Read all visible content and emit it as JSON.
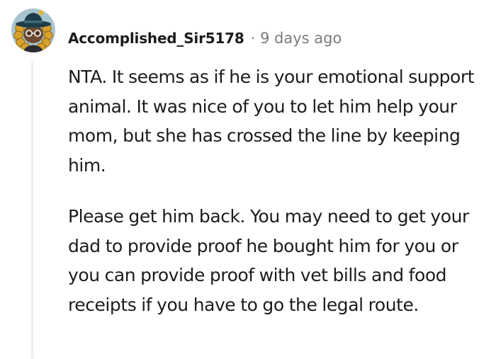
{
  "comment": {
    "author": "Accomplished_Sir5178",
    "separator": "·",
    "timestamp": "9 days ago",
    "avatar_icon": "snoo-avatar-witch-hat-icon",
    "paragraphs": [
      "NTA. It seems as if he is your emotional support animal. It was nice of you to let him help your mom, but she has crossed the line by keeping him.",
      "Please get him back. You may need to get your dad to provide proof he bought him for you or you can provide proof with vet bills and food receipts if you have to go the legal route."
    ]
  },
  "colors": {
    "text": "#1c1c1c",
    "muted": "#7c7c7c",
    "thread_line": "#edeff1",
    "avatar_bg": "#a8c4ce",
    "hat": "#1f3d4a"
  }
}
